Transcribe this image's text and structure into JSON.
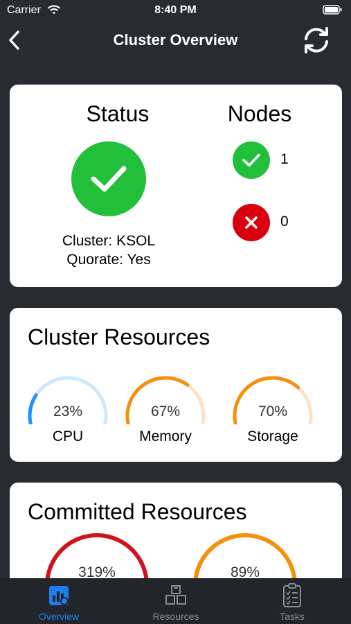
{
  "status_bar": {
    "carrier": "Carrier",
    "time": "8:40 PM"
  },
  "nav": {
    "title": "Cluster Overview",
    "back_icon": "chevron-left-icon",
    "refresh_icon": "refresh-icon"
  },
  "status_card": {
    "title": "Status",
    "cluster_line": "Cluster: KSOL",
    "quorate_line": "Quorate: Yes",
    "status_color": "#22c03a"
  },
  "nodes_card": {
    "title": "Nodes",
    "online_count": "1",
    "offline_count": "0",
    "online_color": "#22c03a",
    "offline_color": "#d9000f"
  },
  "cluster_resources": {
    "title": "Cluster Resources",
    "gauges": [
      {
        "label": "CPU",
        "value_text": "23%",
        "percent": 23,
        "color": "#1e90ff",
        "track": "#cfe6ff"
      },
      {
        "label": "Memory",
        "value_text": "67%",
        "percent": 67,
        "color": "#f5900c",
        "track": "#fde2c2"
      },
      {
        "label": "Storage",
        "value_text": "70%",
        "percent": 70,
        "color": "#f5900c",
        "track": "#fde2c2"
      }
    ]
  },
  "committed_resources": {
    "title": "Committed Resources",
    "gauges": [
      {
        "value_text": "319%",
        "percent": 319,
        "color": "#d0141e"
      },
      {
        "value_text": "89%",
        "percent": 89,
        "color": "#f5900c"
      }
    ]
  },
  "tabs": [
    {
      "label": "Overview",
      "icon": "dashboard-icon",
      "active": true
    },
    {
      "label": "Resources",
      "icon": "boxes-icon",
      "active": false
    },
    {
      "label": "Tasks",
      "icon": "clipboard-list-icon",
      "active": false
    }
  ]
}
